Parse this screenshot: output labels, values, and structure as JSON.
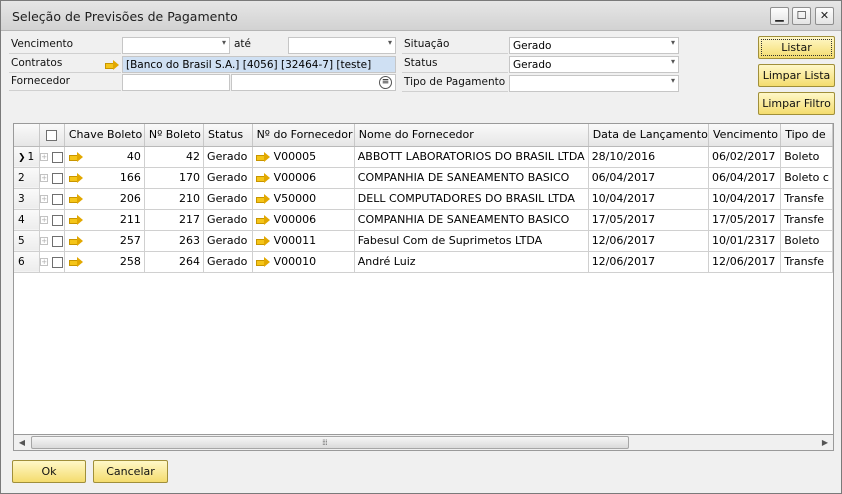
{
  "window": {
    "title": "Seleção de Previsões de Pagamento",
    "minimize_glyph": "▁",
    "maximize_glyph": "☐",
    "close_glyph": "✕"
  },
  "filters": {
    "vencimento_label": "Vencimento",
    "vencimento_from": "",
    "ate_label": "até",
    "vencimento_to": "",
    "contratos_label": "Contratos",
    "contratos_value": "[Banco do Brasil S.A.] [4056] [32464-7] [teste]",
    "fornecedor_label": "Fornecedor",
    "fornecedor_code": "",
    "fornecedor_name": "",
    "situacao_label": "Situação",
    "situacao_value": "Gerado",
    "status_label": "Status",
    "status_value": "Gerado",
    "tipo_pagamento_label": "Tipo de Pagamento",
    "tipo_pagamento_value": ""
  },
  "actions": {
    "listar": "Listar",
    "limpar_lista": "Limpar Lista",
    "limpar_filtro": "Limpar Filtro",
    "ok": "Ok",
    "cancelar": "Cancelar"
  },
  "grid": {
    "columns": [
      "Chave Boleto",
      "Nº Boleto",
      "Status",
      "Nº do Fornecedor",
      "Nome do Fornecedor",
      "Data de Lançamento",
      "Vencimento",
      "Tipo de"
    ],
    "rows": [
      {
        "row": "1",
        "chave": "40",
        "boleto": "42",
        "status": "Gerado",
        "fornecedor": "V00005",
        "nome": "ABBOTT LABORATORIOS DO BRASIL LTDA",
        "lancamento": "28/10/2016",
        "vencimento": "06/02/2017",
        "tipo": "Boleto"
      },
      {
        "row": "2",
        "chave": "166",
        "boleto": "170",
        "status": "Gerado",
        "fornecedor": "V00006",
        "nome": "COMPANHIA DE SANEAMENTO BASICO",
        "lancamento": "06/04/2017",
        "vencimento": "06/04/2017",
        "tipo": "Boleto c"
      },
      {
        "row": "3",
        "chave": "206",
        "boleto": "210",
        "status": "Gerado",
        "fornecedor": "V50000",
        "nome": "DELL COMPUTADORES DO BRASIL LTDA",
        "lancamento": "10/04/2017",
        "vencimento": "10/04/2017",
        "tipo": "Transfe"
      },
      {
        "row": "4",
        "chave": "211",
        "boleto": "217",
        "status": "Gerado",
        "fornecedor": "V00006",
        "nome": "COMPANHIA DE SANEAMENTO BASICO",
        "lancamento": "17/05/2017",
        "vencimento": "17/05/2017",
        "tipo": "Transfe"
      },
      {
        "row": "5",
        "chave": "257",
        "boleto": "263",
        "status": "Gerado",
        "fornecedor": "V00011",
        "nome": "Fabesul Com de Suprimetos LTDA",
        "lancamento": "12/06/2017",
        "vencimento": "10/01/2317",
        "tipo": "Boleto"
      },
      {
        "row": "6",
        "chave": "258",
        "boleto": "264",
        "status": "Gerado",
        "fornecedor": "V00010",
        "nome": "André Luiz",
        "lancamento": "12/06/2017",
        "vencimento": "12/06/2017",
        "tipo": "Transfe"
      }
    ]
  },
  "icons": {
    "link_arrow": "link-arrow-icon",
    "dropdown": "▾",
    "list_choose": "≡",
    "row_pointer": "❯",
    "scroll_left": "◀",
    "scroll_right": "▶",
    "scroll_grip": "⁞⁞⁞"
  }
}
